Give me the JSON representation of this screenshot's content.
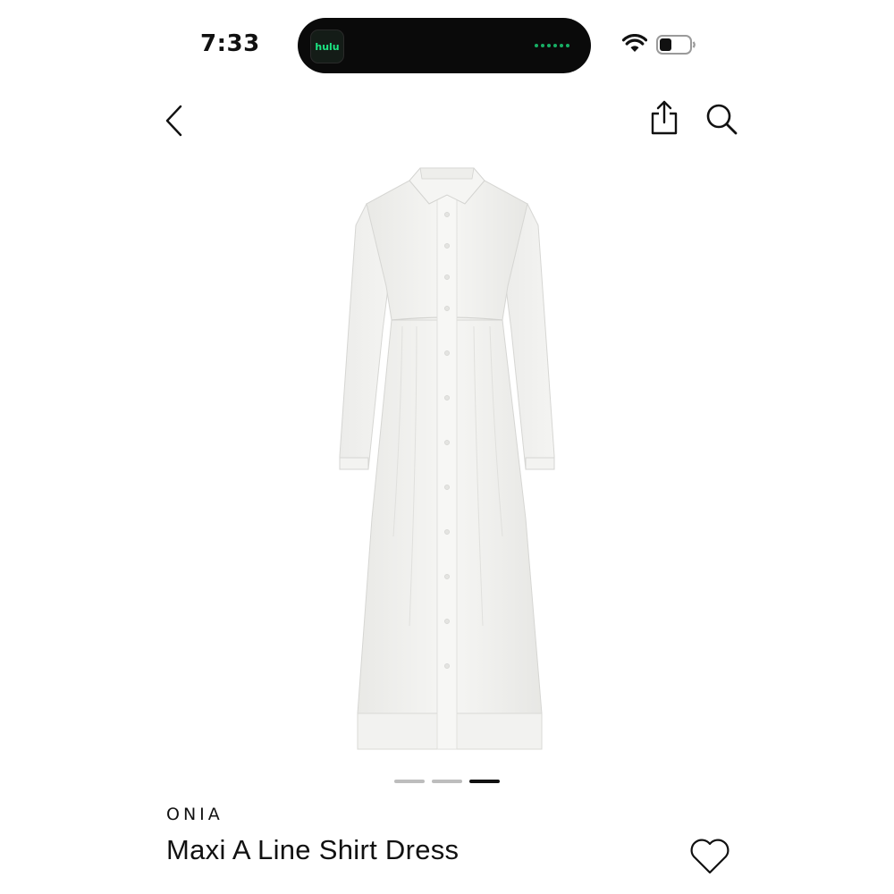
{
  "status_bar": {
    "time": "7:33",
    "now_playing_app": "hulu",
    "now_playing_app_color": "#1ce783"
  },
  "nav": {
    "back_icon": "chevron-left-icon",
    "share_icon": "share-icon",
    "search_icon": "search-icon"
  },
  "gallery": {
    "image_count": 3,
    "active_index": 3
  },
  "product": {
    "brand": "ONIA",
    "name": "Maxi A Line Shirt Dress",
    "favorite_icon": "heart-icon"
  }
}
